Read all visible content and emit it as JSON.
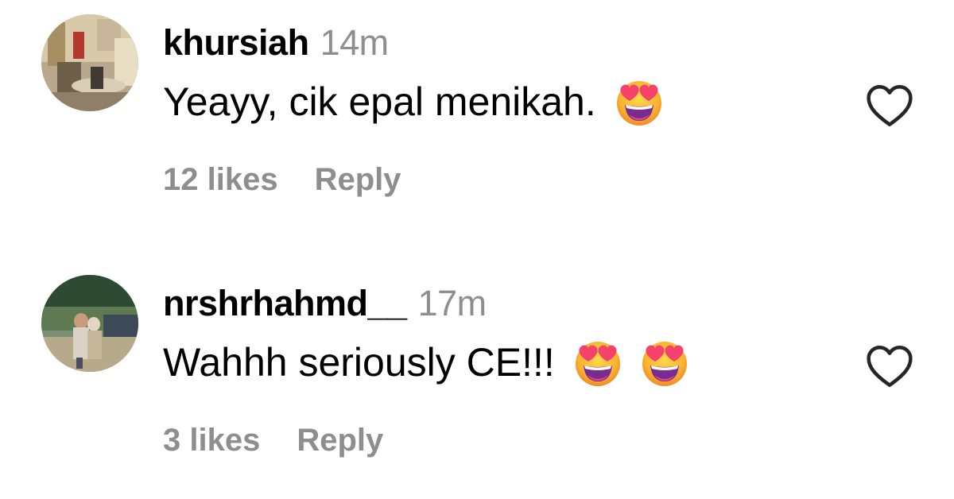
{
  "comments": [
    {
      "username": "khursiah",
      "time": "14m",
      "text": "Yeayy, cik epal menikah.",
      "emoji": [
        "smiling-face-with-heart-eyes"
      ],
      "likes": "12 likes",
      "reply": "Reply"
    },
    {
      "username": "nrshrhahmd__",
      "time": "17m",
      "text": "Wahhh seriously CE!!!",
      "emoji": [
        "smiling-face-with-heart-eyes",
        "smiling-face-with-heart-eyes"
      ],
      "likes": "3 likes",
      "reply": "Reply"
    }
  ],
  "colors": {
    "secondary_text": "#8e8e8e",
    "primary_text": "#000000",
    "heart_outline": "#262626",
    "emoji_face": "#f7b631",
    "emoji_hearts": "#f4426c"
  },
  "icons": {
    "like": "heart-outline-icon"
  }
}
